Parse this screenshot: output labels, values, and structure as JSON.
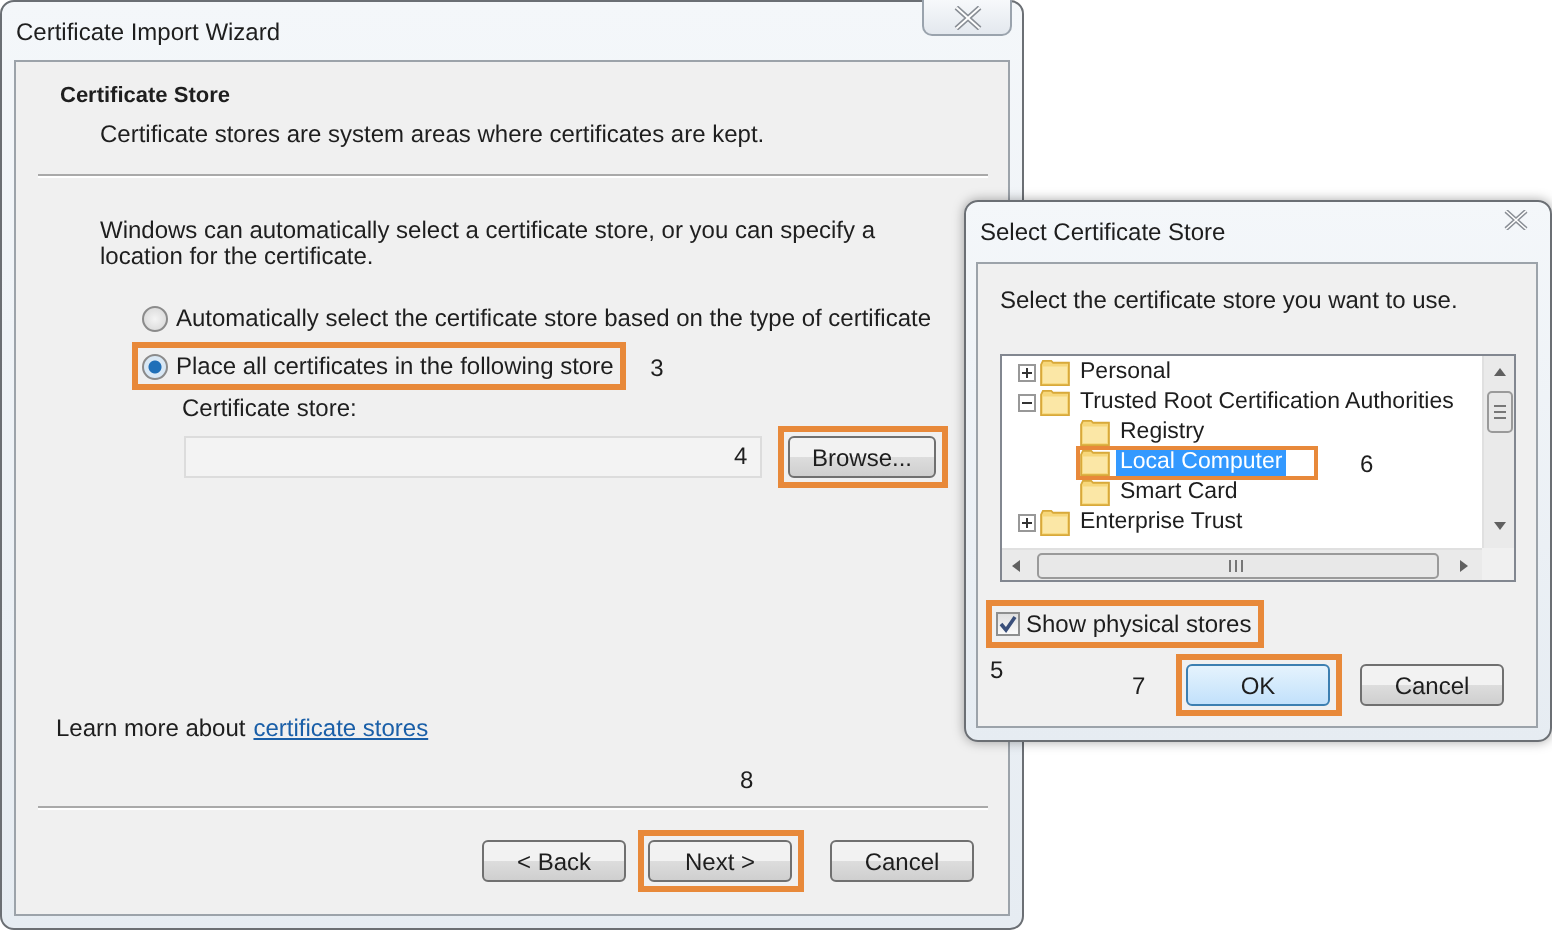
{
  "wizard": {
    "title": "Certificate Import Wizard",
    "heading": "Certificate Store",
    "subheading": "Certificate stores are system areas where certificates are kept.",
    "intro": "Windows can automatically select a certificate store, or you can specify a location for the certificate.",
    "options": [
      {
        "label": "Automatically select the certificate store based on the type of certificate",
        "selected": false
      },
      {
        "label": "Place all certificates in the following store",
        "selected": true,
        "highlighted": true,
        "callout": "3"
      }
    ],
    "store_label": "Certificate store:",
    "browse": {
      "label": "Browse...",
      "highlighted": true,
      "callout": "4"
    },
    "learn_more": {
      "text": "Learn more about",
      "link": "certificate stores"
    },
    "step_callout": "8",
    "buttons": [
      {
        "label": "< Back"
      },
      {
        "label": "Next >",
        "highlighted": true
      },
      {
        "label": "Cancel"
      }
    ]
  },
  "dialog": {
    "title": "Select Certificate Store",
    "prompt": "Select the certificate store you want to use.",
    "tree": [
      {
        "label": "Personal",
        "expanded": false,
        "selected": false
      },
      {
        "label": "Trusted Root Certification Authorities",
        "expanded": true,
        "selected": false,
        "children": [
          {
            "label": "Registry",
            "selected": false
          },
          {
            "label": "Local Computer",
            "selected": true,
            "highlighted": true,
            "callout": "6"
          },
          {
            "label": "Smart Card",
            "selected": false
          }
        ]
      },
      {
        "label": "Enterprise Trust",
        "expanded": false,
        "selected": false
      }
    ],
    "show_physical": {
      "label": "Show physical stores",
      "checked": true,
      "highlighted": true,
      "callout": "5"
    },
    "buttons": [
      {
        "label": "OK",
        "default": true,
        "highlighted": true,
        "callout": "7"
      },
      {
        "label": "Cancel",
        "default": false
      }
    ]
  }
}
